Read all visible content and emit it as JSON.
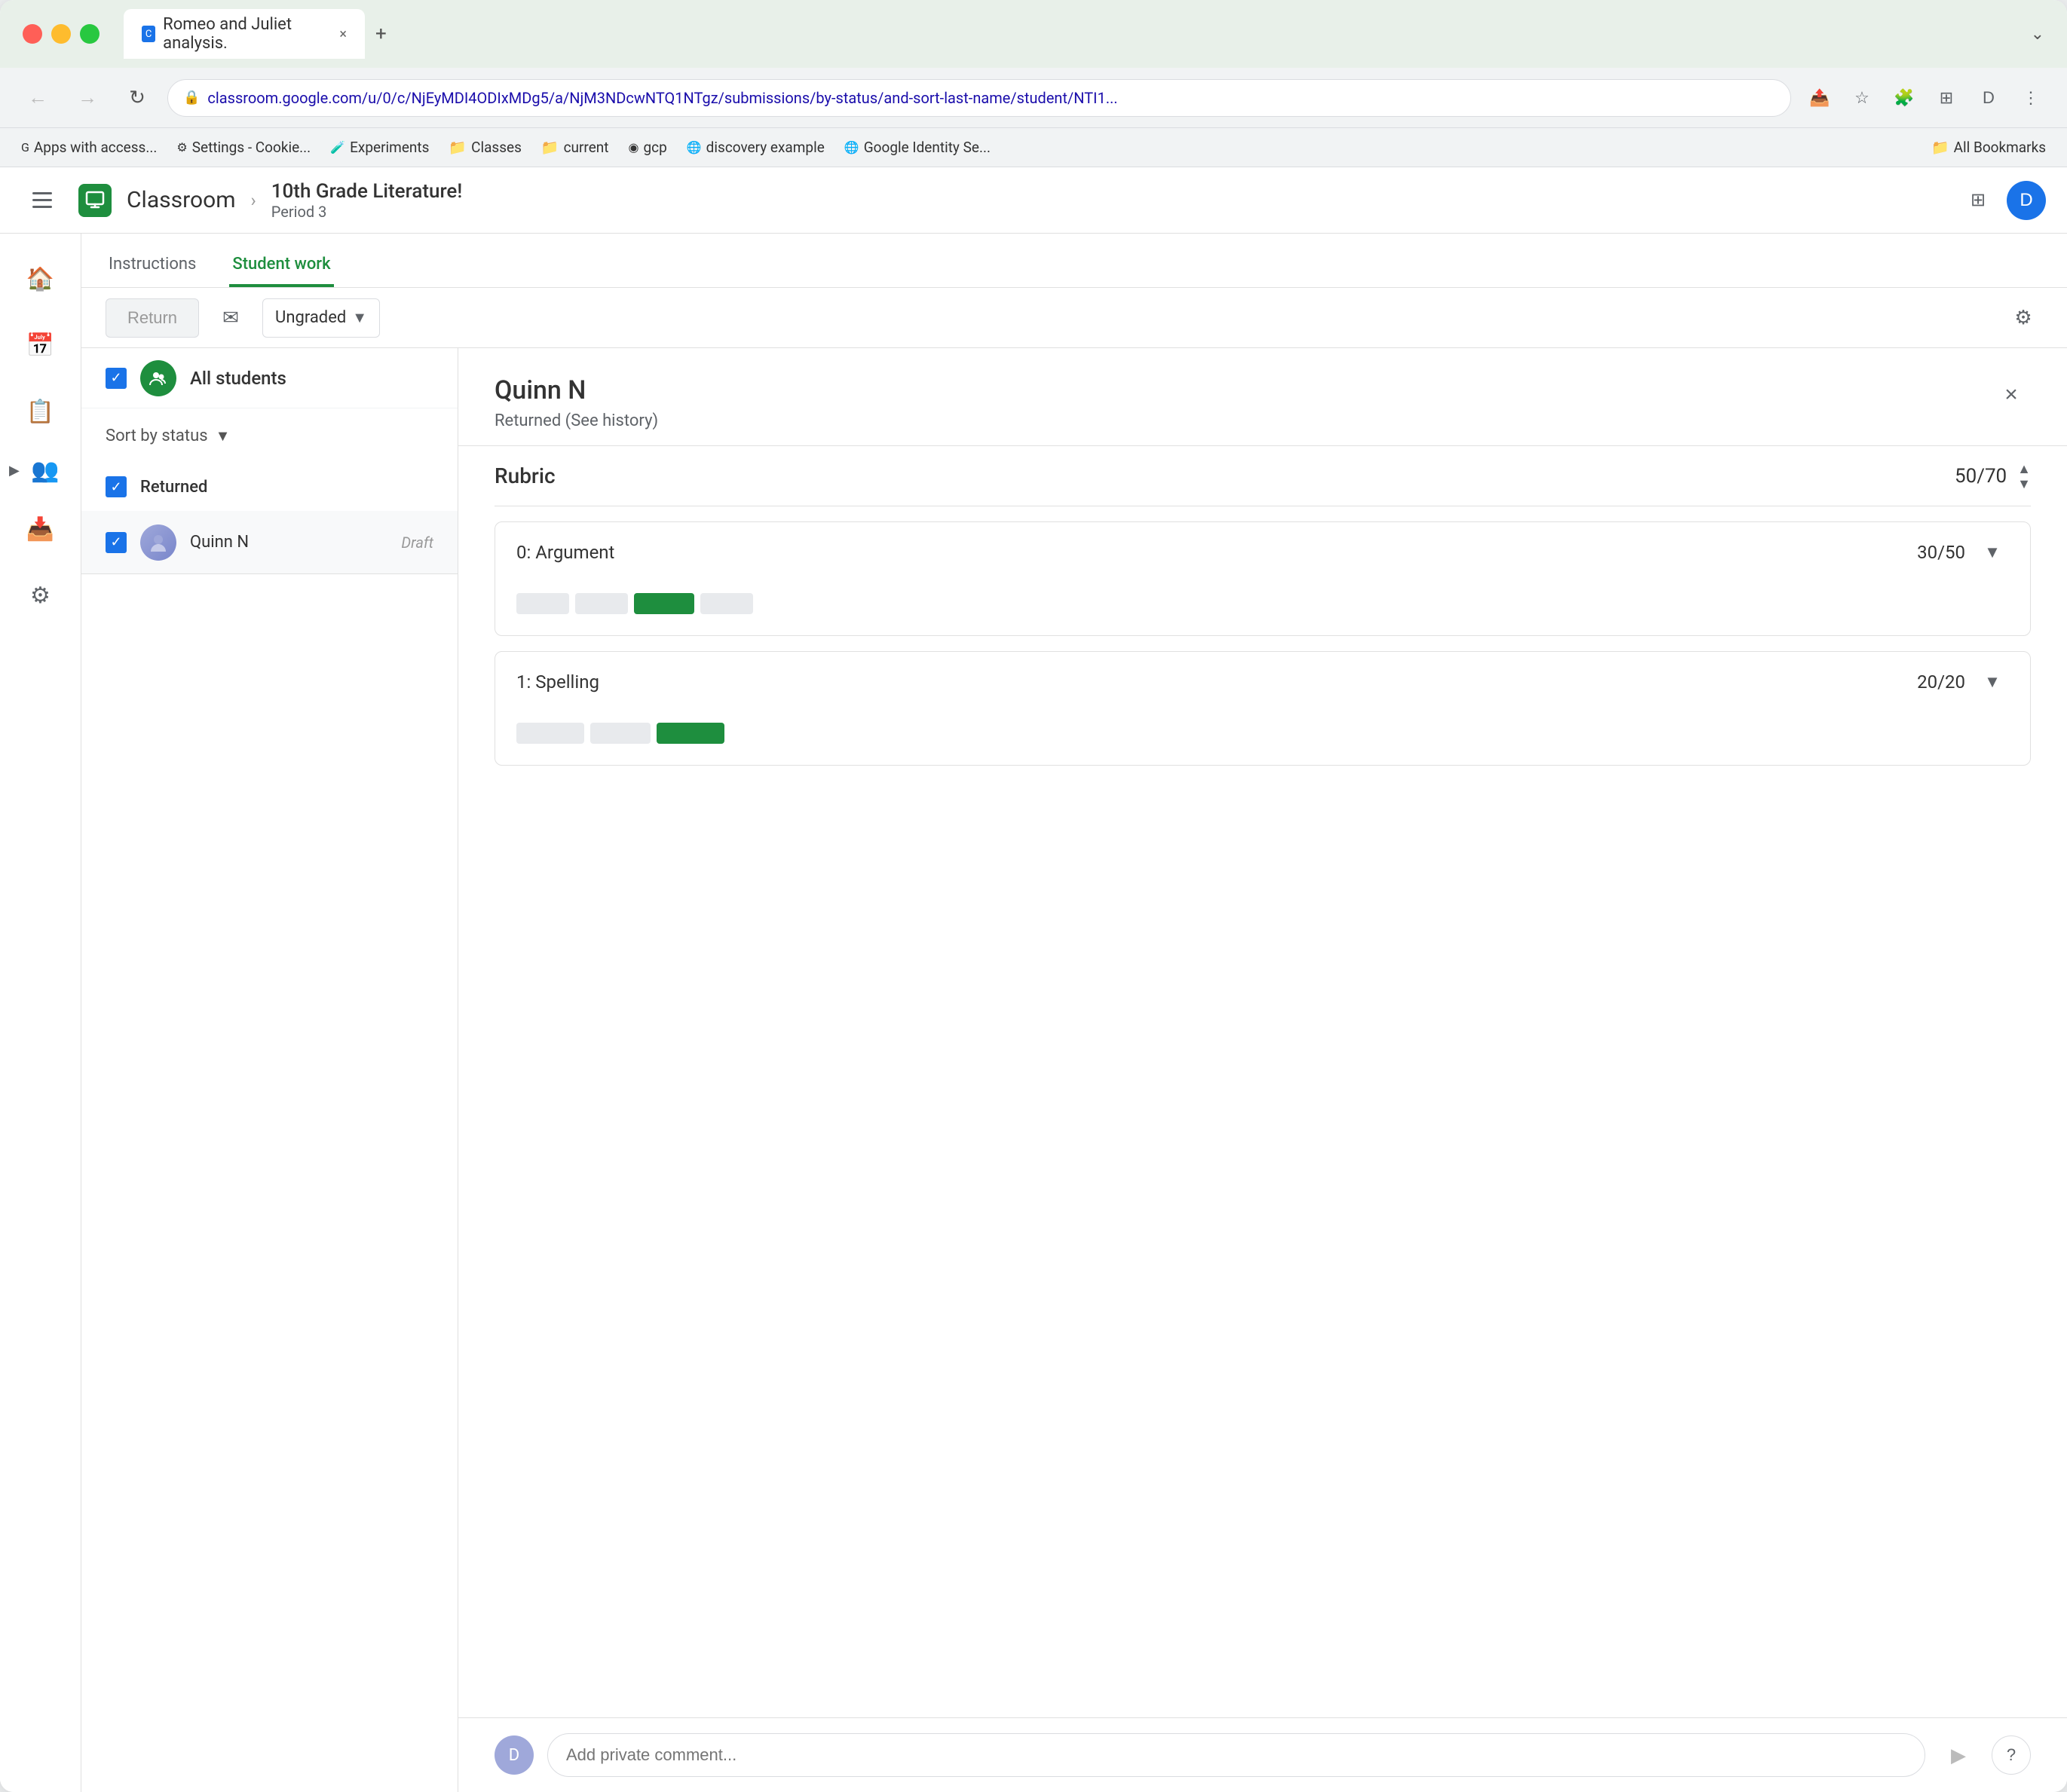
{
  "browser": {
    "tab_title": "Romeo and Juliet analysis.",
    "tab_close": "×",
    "tab_add": "+",
    "tab_menu": "⌄",
    "url": "classroom.google.com/u/0/c/NjEyMDI4ODIxMDg5/a/NjM3NDcwNTQ1NTgz/submissions/by-status/and-sort-last-name/student/NTI1...",
    "back_disabled": false,
    "forward_disabled": true
  },
  "bookmarks": [
    {
      "id": "apps",
      "label": "Apps with access...",
      "icon": "G"
    },
    {
      "id": "settings",
      "label": "Settings - Cookie...",
      "icon": "⚙"
    },
    {
      "id": "experiments",
      "label": "Experiments",
      "icon": "🔬"
    },
    {
      "id": "classes",
      "label": "Classes",
      "icon": "📁"
    },
    {
      "id": "current",
      "label": "current",
      "icon": "📁"
    },
    {
      "id": "gcp",
      "label": "gcp",
      "icon": "◉"
    },
    {
      "id": "discovery",
      "label": "discovery example",
      "icon": "🌐"
    },
    {
      "id": "google-identity",
      "label": "Google Identity Se...",
      "icon": "🌐"
    },
    {
      "id": "all-bookmarks",
      "label": "All Bookmarks",
      "icon": "📁"
    }
  ],
  "app": {
    "logo_letter": "C",
    "app_name": "Classroom",
    "breadcrumb_arrow": "›",
    "course_title": "10th Grade Literature!",
    "course_period": "Period 3",
    "avatar_letter": "D"
  },
  "tabs": [
    {
      "id": "instructions",
      "label": "Instructions",
      "active": false
    },
    {
      "id": "student-work",
      "label": "Student work",
      "active": true
    }
  ],
  "toolbar": {
    "return_label": "Return",
    "grade_label": "Ungraded",
    "return_disabled": true
  },
  "students": {
    "all_students_label": "All students",
    "sort_label": "Sort by status",
    "status_returned": "Returned",
    "student_name": "Quinn N",
    "student_status": "Draft"
  },
  "right_panel": {
    "student_name": "Quinn N",
    "submission_status": "Returned (See history)",
    "rubric_title": "Rubric",
    "rubric_score": "50",
    "rubric_max": "70",
    "close_icon": "×",
    "criteria": [
      {
        "id": "argument",
        "name": "0: Argument",
        "score": "30",
        "max": "50",
        "segments": [
          {
            "width": 60,
            "active": false
          },
          {
            "width": 60,
            "active": false
          },
          {
            "width": 70,
            "active": true
          },
          {
            "width": 60,
            "active": false
          }
        ]
      },
      {
        "id": "spelling",
        "name": "1: Spelling",
        "score": "20",
        "max": "20",
        "segments": [
          {
            "width": 80,
            "active": false
          },
          {
            "width": 70,
            "active": false
          },
          {
            "width": 80,
            "active": true
          }
        ]
      }
    ]
  },
  "comment": {
    "placeholder": "Add private comment...",
    "send_icon": "▶",
    "help_icon": "?"
  }
}
